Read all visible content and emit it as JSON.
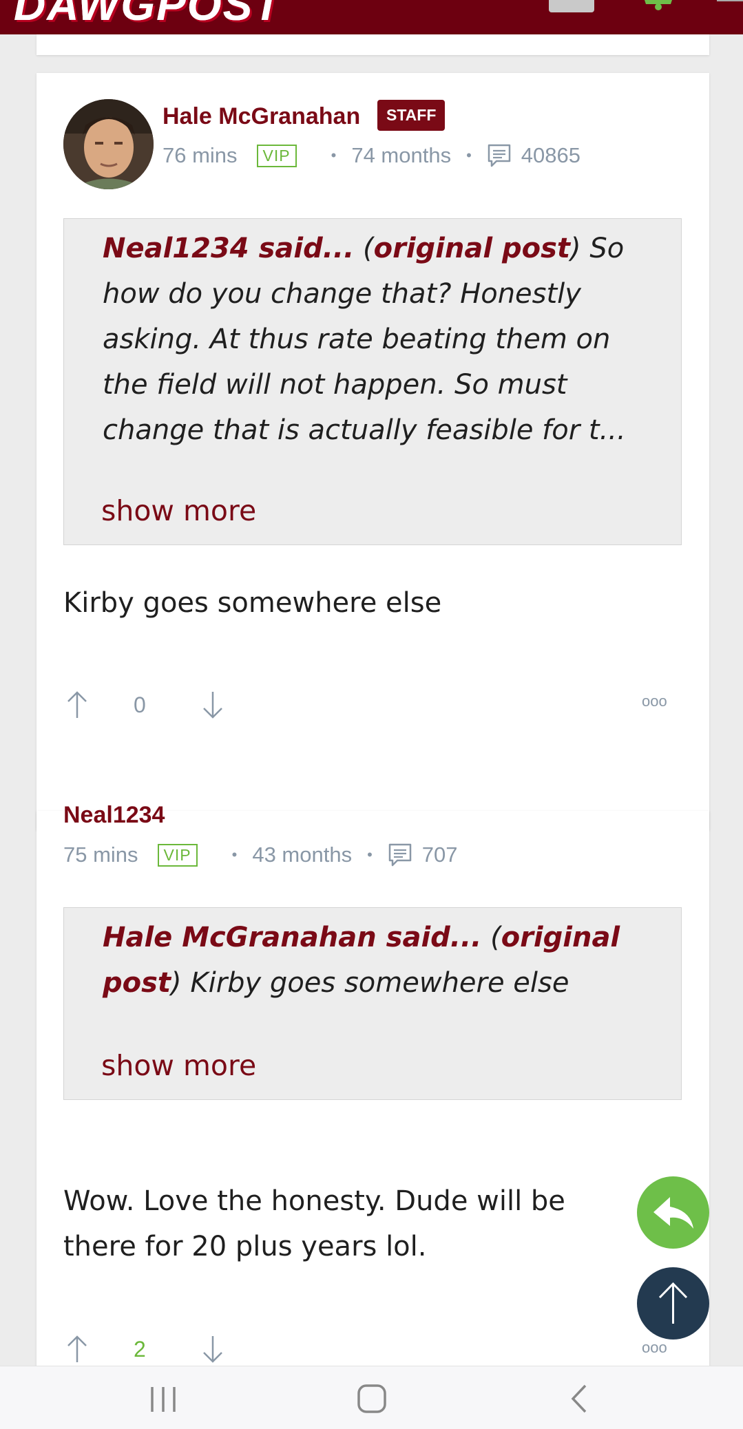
{
  "header": {
    "logo_text": "DAWGPOST",
    "brand_color": "#6d0010",
    "icons": [
      "user-avatar-icon",
      "notification-bell-icon"
    ]
  },
  "posts": [
    {
      "username": "Hale McGranahan",
      "badge": "STAFF",
      "time": "76 mins",
      "vip": "VIP",
      "member_for": "74 months",
      "post_count": "40865",
      "quote": {
        "author": "Neal1234 said...",
        "open_paren": "(",
        "link": "original post",
        "close_paren": ")",
        "line1_rest": "So",
        "line2": "how do you change that? Honestly",
        "line3": "asking. At thus rate beating them on",
        "line4": "the field will not happen. So must",
        "line5": "change that is actually feasible for t..."
      },
      "show_more": "show more",
      "body": "Kirby goes somewhere else",
      "votes": "0",
      "more": "ooo"
    },
    {
      "username": "Neal1234",
      "time": "75 mins",
      "vip": "VIP",
      "member_for": "43 months",
      "post_count": "707",
      "quote": {
        "author": "Hale McGranahan said...",
        "open_paren": "(",
        "link_line1": "original",
        "link_line2": "post",
        "close_rest": ") Kirby goes somewhere else"
      },
      "show_more": "show more",
      "body_line1": "Wow. Love the honesty. Dude will be",
      "body_line2": "there for 20 plus years lol.",
      "votes": "2",
      "more": "ooo"
    }
  ],
  "colors": {
    "accent_maroon": "#7a0a16",
    "vip_green": "#6bb83a",
    "meta_gray": "#8997a6",
    "reply_fab": "#6ebf49",
    "top_fab": "#233a50"
  }
}
